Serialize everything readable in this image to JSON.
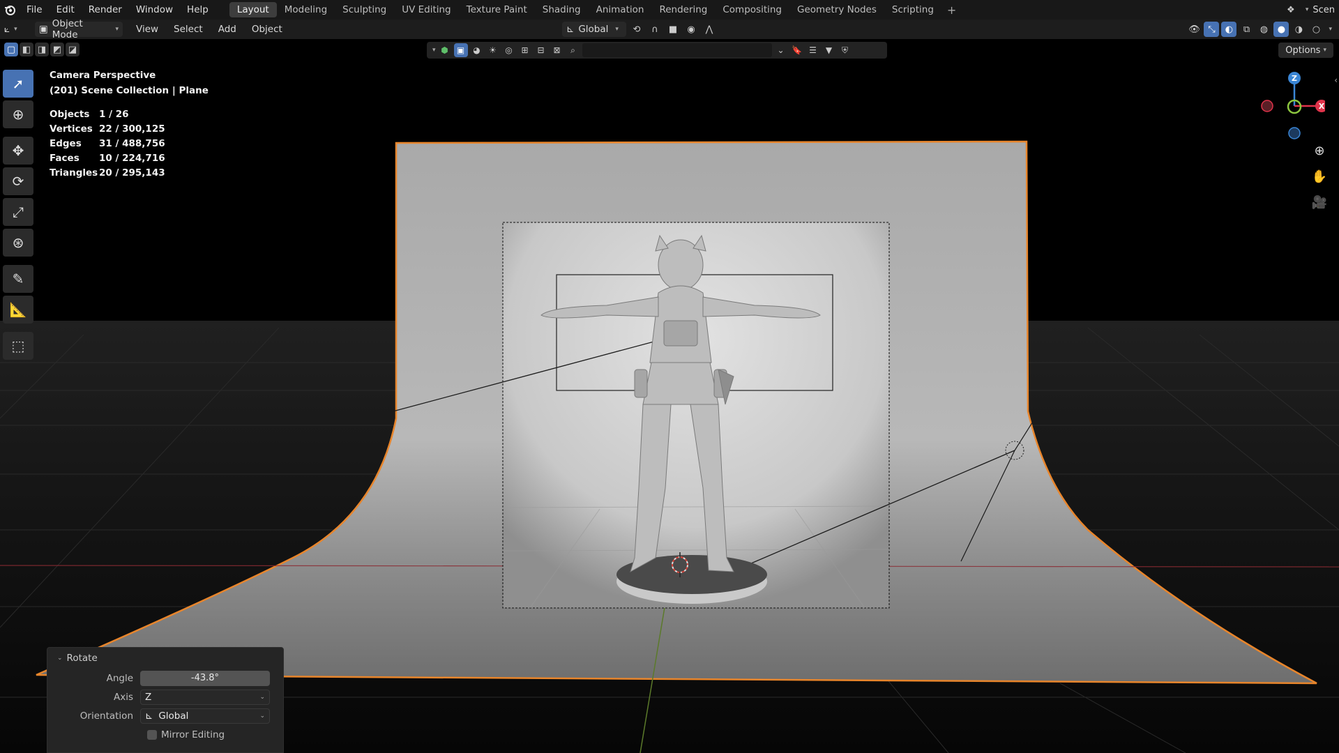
{
  "app": {
    "logo_icon": "blender-logo-icon",
    "menu": [
      "File",
      "Edit",
      "Render",
      "Window",
      "Help"
    ],
    "workspaces": [
      "Layout",
      "Modeling",
      "Sculpting",
      "UV Editing",
      "Texture Paint",
      "Shading",
      "Animation",
      "Rendering",
      "Compositing",
      "Geometry Nodes",
      "Scripting"
    ],
    "active_workspace": "Layout",
    "add_workspace": "+",
    "scene_name": "Scen"
  },
  "header": {
    "mode": "Object Mode",
    "menus": [
      "View",
      "Select",
      "Add",
      "Object"
    ],
    "transform_orientation": "Global",
    "options": "Options"
  },
  "overlay": {
    "view_name": "Camera Perspective",
    "collection_info": "(201) Scene Collection | Plane",
    "stats": [
      {
        "label": "Objects",
        "value": "1 / 26"
      },
      {
        "label": "Vertices",
        "value": "22 / 300,125"
      },
      {
        "label": "Edges",
        "value": "31 / 488,756"
      },
      {
        "label": "Faces",
        "value": "10 / 224,716"
      },
      {
        "label": "Triangles",
        "value": "20 / 295,143"
      }
    ]
  },
  "gizmo": {
    "x": "X",
    "y": "Y",
    "z": "Z",
    "x_color": "#e0334a",
    "y_color": "#8cc63f",
    "z_color": "#3a86d6"
  },
  "operator_panel": {
    "title": "Rotate",
    "angle_label": "Angle",
    "angle_value": "-43.8°",
    "axis_label": "Axis",
    "axis_value": "Z",
    "orientation_label": "Orientation",
    "orientation_value": "Global",
    "mirror_label": "Mirror Editing",
    "mirror_checked": false
  },
  "colors": {
    "accent": "#4772b3",
    "selection_outline": "#e8852b"
  }
}
